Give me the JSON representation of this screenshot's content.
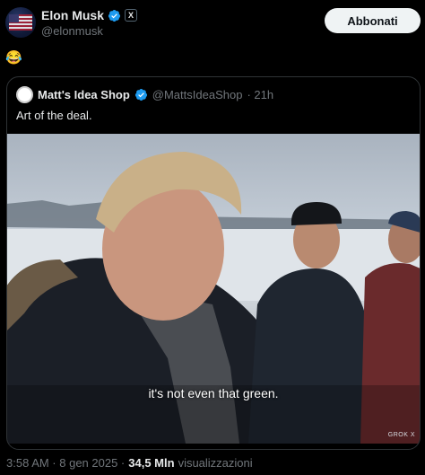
{
  "post": {
    "author_name": "Elon Musk",
    "author_handle": "@elonmusk",
    "affiliate_badge": "X",
    "follow_label": "Abbonati",
    "text": "😂",
    "timestamp": "3:58 AM · 8 gen 2025 ·",
    "views_count": "34,5 Mln",
    "views_label": "visualizzazioni"
  },
  "quoted": {
    "author_name": "Matt's Idea Shop",
    "author_handle": "@MattsIdeaShop",
    "time": "· 21h",
    "text": "Art of the deal.",
    "media_subtitle": "it's not even that green.",
    "media_watermark": "GROK X"
  },
  "colors": {
    "background": "#000000",
    "verified_blue": "#1d9bf0",
    "follow_button_bg": "#eff3f4",
    "secondary_text": "#71767b"
  },
  "icons": [
    "verified-badge-icon",
    "x-affiliate-icon"
  ]
}
